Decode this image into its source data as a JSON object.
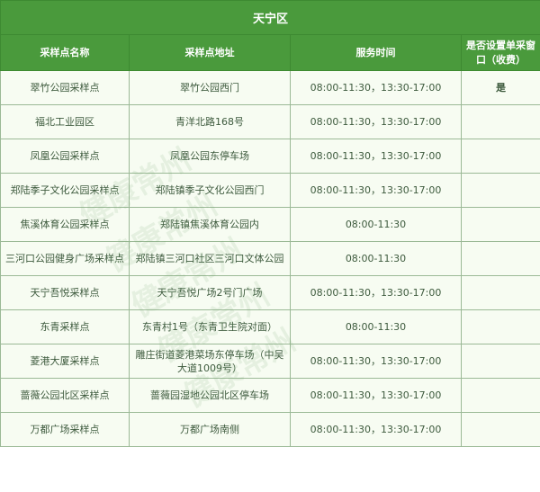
{
  "district": "天宁区",
  "columns": [
    "采样点名称",
    "采样点地址",
    "服务时间",
    "是否设置单采窗口（收费）"
  ],
  "rows": [
    {
      "name": "翠竹公园采样点",
      "address": "翠竹公园西门",
      "hours": "08:00-11:30，13:30-17:00",
      "single_window": "是"
    },
    {
      "name": "福北工业园区",
      "address": "青洋北路168号",
      "hours": "08:00-11:30，13:30-17:00",
      "single_window": ""
    },
    {
      "name": "凤凰公园采样点",
      "address": "凤凰公园东停车场",
      "hours": "08:00-11:30，13:30-17:00",
      "single_window": ""
    },
    {
      "name": "郑陆季子文化公园采样点",
      "address": "郑陆镇季子文化公园西门",
      "hours": "08:00-11:30，13:30-17:00",
      "single_window": ""
    },
    {
      "name": "焦溪体育公园采样点",
      "address": "郑陆镇焦溪体育公园内",
      "hours": "08:00-11:30",
      "single_window": ""
    },
    {
      "name": "三河口公园健身广场采样点",
      "address": "郑陆镇三河口社区三河口文体公园",
      "hours": "08:00-11:30",
      "single_window": ""
    },
    {
      "name": "天宁吾悦采样点",
      "address": "天宁吾悦广场2号门广场",
      "hours": "08:00-11:30，13:30-17:00",
      "single_window": ""
    },
    {
      "name": "东青采样点",
      "address": "东青村1号（东青卫生院对面）",
      "hours": "08:00-11:30",
      "single_window": ""
    },
    {
      "name": "菱港大厦采样点",
      "address": "雕庄街道菱港菜场东停车场（中吴大道1009号）",
      "hours": "08:00-11:30，13:30-17:00",
      "single_window": ""
    },
    {
      "name": "蔷薇公园北区采样点",
      "address": "蔷薇园湿地公园北区停车场",
      "hours": "08:00-11:30，13:30-17:00",
      "single_window": ""
    },
    {
      "name": "万都广场采样点",
      "address": "万都广场南侧",
      "hours": "08:00-11:30，13:30-17:00",
      "single_window": ""
    }
  ],
  "watermark": "健康常州"
}
